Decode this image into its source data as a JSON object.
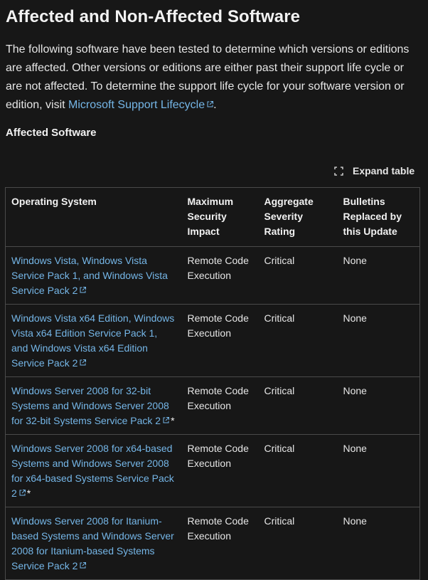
{
  "heading": "Affected and Non-Affected Software",
  "intro": {
    "text_before_link": "The following software have been tested to determine which versions or editions are affected. Other versions or editions are either past their support life cycle or are not affected. To determine the support life cycle for your software version or edition, visit ",
    "link_label": "Microsoft Support Lifecycle",
    "text_after_link": "."
  },
  "section_title": "Affected Software",
  "expand_label": "Expand table",
  "table": {
    "headers": [
      "Operating System",
      "Maximum Security Impact",
      "Aggregate Severity Rating",
      "Bulletins Replaced by this Update"
    ],
    "rows": [
      {
        "os": "Windows Vista, Windows Vista Service Pack 1, and Windows Vista Service Pack 2",
        "asterisk": "",
        "impact": "Remote Code Execution",
        "severity": "Critical",
        "replaced": "None"
      },
      {
        "os": "Windows Vista x64 Edition, Windows Vista x64 Edition Service Pack 1, and Windows Vista x64 Edition Service Pack 2",
        "asterisk": "",
        "impact": "Remote Code Execution",
        "severity": "Critical",
        "replaced": "None"
      },
      {
        "os": "Windows Server 2008 for 32-bit Systems and Windows Server 2008 for 32-bit Systems Service Pack 2",
        "asterisk": "*",
        "impact": "Remote Code Execution",
        "severity": "Critical",
        "replaced": "None"
      },
      {
        "os": "Windows Server 2008 for x64-based Systems and Windows Server 2008 for x64-based Systems Service Pack 2",
        "asterisk": "*",
        "impact": "Remote Code Execution",
        "severity": "Critical",
        "replaced": "None"
      },
      {
        "os": "Windows Server 2008 for Itanium-based Systems and Windows Server 2008 for Itanium-based Systems Service Pack 2",
        "asterisk": "",
        "impact": "Remote Code Execution",
        "severity": "Critical",
        "replaced": "None"
      }
    ]
  },
  "colors": {
    "background": "#171717",
    "text": "#e6e6e6",
    "link": "#75b6e7",
    "border": "#4a4a4a"
  },
  "icons": {
    "external_link": "external-link-icon",
    "expand": "expand-icon"
  }
}
